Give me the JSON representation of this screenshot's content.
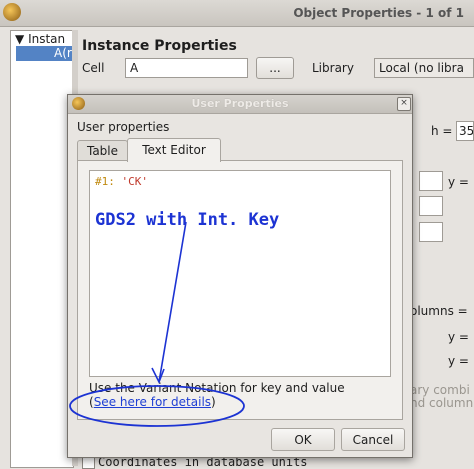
{
  "main_window": {
    "title": "Object Properties - 1 of 1",
    "tree": {
      "root": "Instan",
      "child": "A(r"
    },
    "instance_heading": "Instance Properties",
    "cell_label": "Cell",
    "cell_value": "A",
    "browse_label": "...",
    "library_label": "Library",
    "library_value": "Local (no libra",
    "h_label": "h =",
    "h_value": "35",
    "y_label": "y =",
    "columns_label": "olumns =",
    "y_label_2": "y =",
    "y_label_3": "y =",
    "array_hint": "ary combi",
    "nd_hint": "nd column",
    "coords_label": "Coordinates in database units"
  },
  "dialog": {
    "title": "User Properties",
    "close_glyph": "×",
    "heading": "User properties",
    "tabs": [
      {
        "label": "Table",
        "active": false
      },
      {
        "label": "Text Editor",
        "active": true
      }
    ],
    "editor": {
      "line_number": "#1:",
      "line_value": "'CK'"
    },
    "annotation": "GDS2 with Int. Key",
    "variant_text": "Use the Variant Notation for key and value",
    "details_open": "(",
    "details_link": "See here for details",
    "details_close": ")",
    "ok_label": "OK",
    "cancel_label": "Cancel"
  },
  "colors": {
    "annotation_blue": "#1c33d3",
    "selection_blue": "#5383c5",
    "code_number": "#c08a10",
    "code_string": "#c0392b"
  }
}
